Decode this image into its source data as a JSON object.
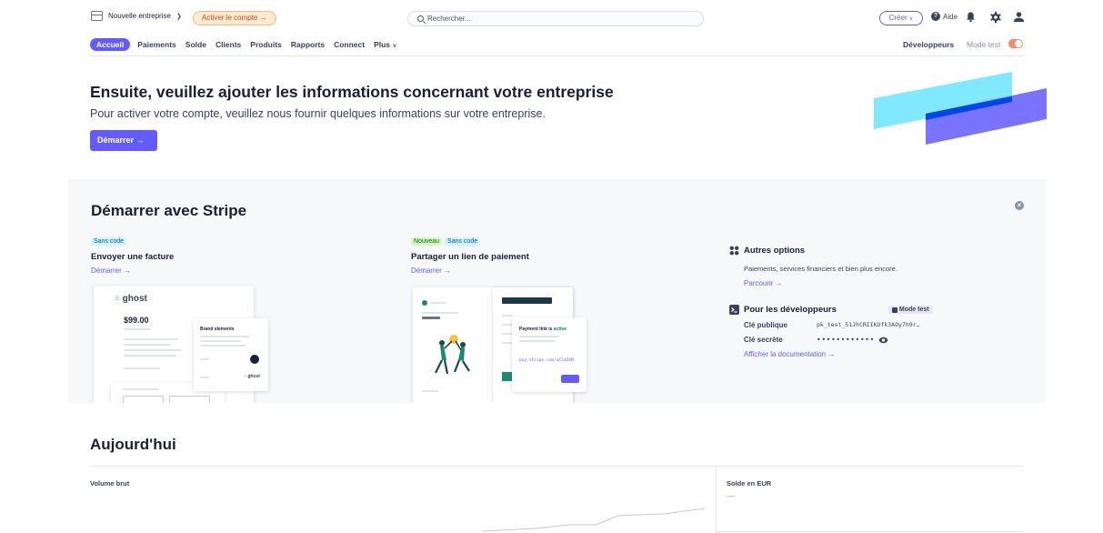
{
  "topbar": {
    "account_name": "Nouvelle entreprise",
    "activate_label": "Activer le compte →",
    "search_placeholder": "Rechercher...",
    "create_label": "Créer",
    "help_label": "Aide",
    "icons": [
      "account-icon",
      "search-icon",
      "help-icon",
      "bell-icon",
      "gear-icon",
      "user-icon"
    ]
  },
  "nav": {
    "items": [
      "Accueil",
      "Paiements",
      "Solde",
      "Clients",
      "Produits",
      "Rapports",
      "Connect",
      "Plus"
    ],
    "active": "Accueil",
    "developers_label": "Développeurs",
    "test_mode_label": "Mode test"
  },
  "hero": {
    "title": "Ensuite, veuillez ajouter les informations concernant votre entreprise",
    "subtitle": "Pour activer votre compte, veuillez nous fournir quelques informations sur votre entreprise.",
    "button_label": "Démarrer →"
  },
  "get_started": {
    "title": "Démarrer avec Stripe",
    "invoice": {
      "badge": "Sans code",
      "title": "Envoyer une facture",
      "link": "Démarrer →",
      "preview": {
        "logo": "ghost",
        "amount": "$99.00",
        "brand_title": "Brand elements",
        "brand_logo": "ghost"
      }
    },
    "payment_link": {
      "badges": [
        "Nouveau",
        "Sans code"
      ],
      "title": "Partager un lien de paiement",
      "link": "Démarrer →",
      "preview": {
        "title_prefix": "Payment link is",
        "title_status": "active",
        "url": "buy.stripe.com/aF2aZ4M"
      }
    },
    "other": {
      "title": "Autres options",
      "text": "Paiements, services financiers et bien plus encore.",
      "link": "Parcourir →"
    },
    "developers": {
      "title": "Pour les développeurs",
      "mode_badge": "Mode test",
      "public_key_label": "Clé publique",
      "public_key_value": "pk_test_51JhCRIIKUfk3AOy7h9r…",
      "secret_key_label": "Clé secrète",
      "secret_key_value": "••••••••••••",
      "doc_link": "Afficher la documentation →"
    }
  },
  "today": {
    "title": "Aujourd'hui",
    "gross_volume_label": "Volume brut",
    "balance_label": "Solde en EUR",
    "balance_value": "—"
  },
  "colors": {
    "accent": "#635bff",
    "activate_bg": "#fde9d1",
    "activate_text": "#c44c1e",
    "panel_bg": "#f6f8fa",
    "toggle": "#f28b64"
  }
}
